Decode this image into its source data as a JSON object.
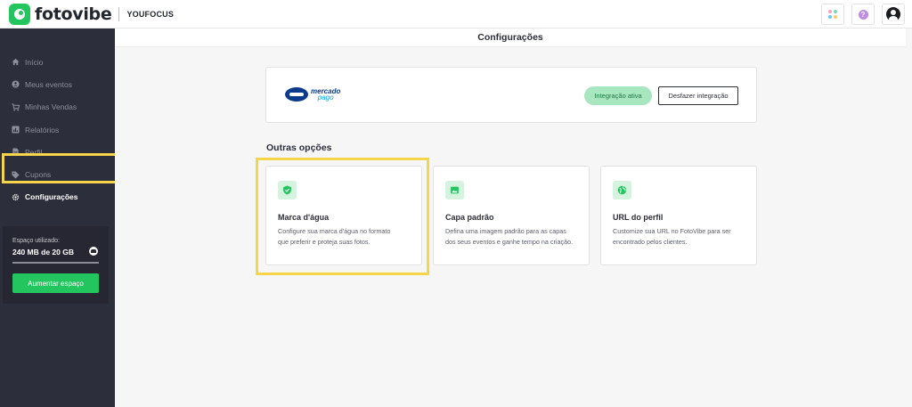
{
  "app": {
    "logo_text": "fotovibe",
    "brand": "YOUFOCUS",
    "help_glyph": "?",
    "colors": {
      "accent": "#22c55e",
      "sidebar": "#2d2e3b",
      "highlight": "#f7d54a",
      "mp_blue": "#0b3b8a",
      "mp_light": "#00a2e6"
    }
  },
  "sidebar": {
    "items": [
      {
        "label": "Início",
        "icon": "home-icon"
      },
      {
        "label": "Meus eventos",
        "icon": "events-icon"
      },
      {
        "label": "Minhas Vendas",
        "icon": "cart-icon"
      },
      {
        "label": "Relatórios",
        "icon": "reports-icon"
      },
      {
        "label": "Perfil",
        "icon": "profile-icon"
      },
      {
        "label": "Cupons",
        "icon": "tag-icon"
      },
      {
        "label": "Configurações",
        "icon": "gear-icon",
        "active": true
      }
    ],
    "storage": {
      "label": "Espaço utilizado:",
      "value": "240 MB de 20 GB",
      "button": "Aumentar espaço"
    }
  },
  "main": {
    "title": "Configurações",
    "integration": {
      "logo_line1": "mercado",
      "logo_line2": "pago",
      "status": "Integração ativa",
      "undo_button": "Desfazer integração"
    },
    "section_title": "Outras opções",
    "options": [
      {
        "title": "Marca d'água",
        "desc_line1": "Configure sua marca d'água no formato",
        "desc_line2": "que preferir e proteja suas fotos.",
        "icon": "shield-icon"
      },
      {
        "title": "Capa padrão",
        "desc_line1": "Defina uma imagem padrão para as capas",
        "desc_line2": "dos seus eventos e ganhe tempo na criação.",
        "icon": "image-icon"
      },
      {
        "title": "URL do perfil",
        "desc_line1": "Customize sua URL no FotoVibe para ser",
        "desc_line2": "encontrado pelos clientes.",
        "icon": "globe-icon"
      }
    ]
  }
}
